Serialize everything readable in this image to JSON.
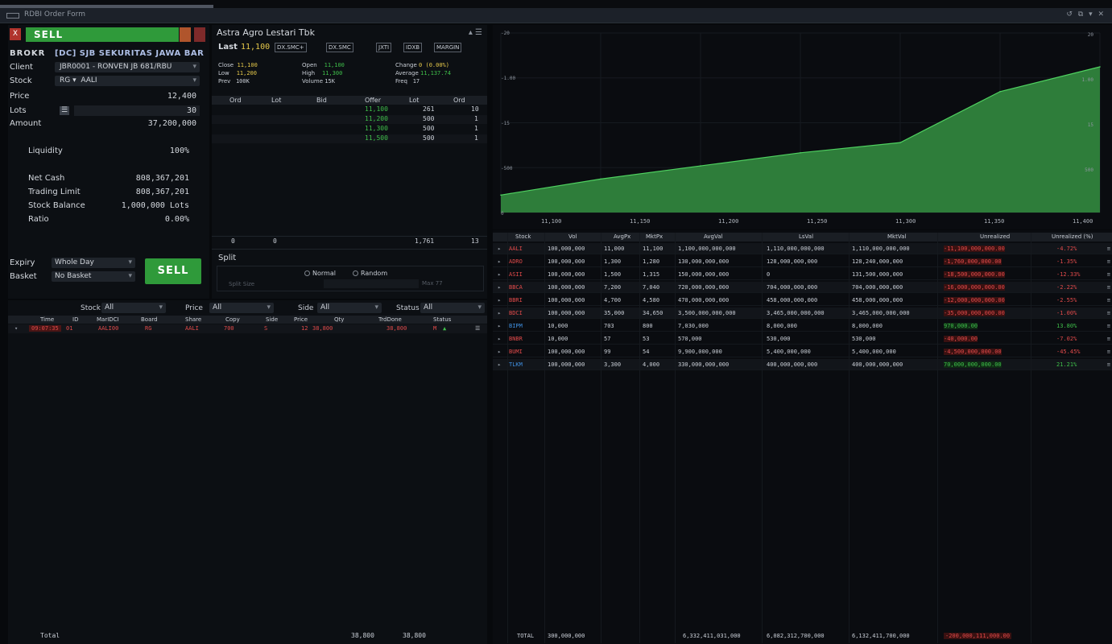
{
  "window": {
    "title": "RDBI Order Form",
    "controls": "↺ ⧉ ▾ ✕"
  },
  "order": {
    "side_label": "SELL",
    "close_label": "X",
    "broker_label": "BROKR",
    "broker_value": "[DC] SJB SEKURITAS JAWA BAR",
    "client_label": "Client",
    "client_value": "JBR0001 - RONVEN JB 681/RBU",
    "stock_label": "Stock",
    "stock_board": "RG ▾",
    "stock_code": "AALI",
    "price_label": "Price",
    "price_value": "12,400",
    "lots_label": "Lots",
    "lots_value": "30",
    "amount_label": "Amount",
    "amount_value": "37,200,000",
    "liquidity_label": "Liquidity",
    "liquidity_value": "100%",
    "netcash_label": "Net Cash",
    "netcash_value": "808,367,201",
    "tradinglimit_label": "Trading Limit",
    "tradinglimit_value": "808,367,201",
    "stockbalance_label": "Stock Balance",
    "stockbalance_value": "1,000,000 Lots",
    "ratio_label": "Ratio",
    "ratio_value": "0.00%",
    "expiry_label": "Expiry",
    "expiry_value": "Whole Day",
    "basket_label": "Basket",
    "basket_value": "No Basket",
    "submit_label": "SELL"
  },
  "quote": {
    "title": "Astra Agro Lestari Tbk",
    "last_label": "Last",
    "last_value": "11,100",
    "badges": [
      "DX.SMC+",
      "DX.SMC",
      "JXTI",
      "IDXB",
      "MARGIN"
    ],
    "close_label": "Close",
    "close_value": "11,100",
    "low_label": "Low",
    "low_value": "11,200",
    "prev_label": "Prev",
    "prev_value": "100K",
    "open_label": "Open",
    "open_value": "11,100",
    "high_label": "High",
    "high_value": "11,300",
    "volume_label": "Volume",
    "volume_value": "15K",
    "change_label": "Change",
    "change_value": "0 (0.00%)",
    "average_label": "Average",
    "average_value": "11,137.74",
    "freq_label": "Freq",
    "freq_value": "17",
    "book_headers": [
      "Ord",
      "Lot",
      "Bid",
      "Offer",
      "Lot",
      "Ord"
    ],
    "book_rows": [
      {
        "offer": "11,100",
        "lot": "261",
        "ord": "10"
      },
      {
        "offer": "11,200",
        "lot": "500",
        "ord": "1"
      },
      {
        "offer": "11,300",
        "lot": "500",
        "ord": "1"
      },
      {
        "offer": "11,500",
        "lot": "500",
        "ord": "1"
      }
    ],
    "book_total": {
      "bid_ord": "0",
      "bid_lot": "0",
      "offer_lot": "1,761",
      "offer_ord": "13"
    },
    "split_label": "Split",
    "radio_normal": "Normal",
    "radio_random": "Random",
    "split_placeholder": "Split Size",
    "split_max": "Max 77"
  },
  "orders": {
    "filter_stock_label": "Stock",
    "filter_stock_value": "All",
    "filter_price_label": "Price",
    "filter_price_value": "All",
    "filter_side_label": "Side",
    "filter_side_value": "All",
    "filter_status_label": "Status",
    "filter_status_value": "All",
    "headers": [
      "Time",
      "ID",
      "MarIDCI",
      "Board",
      "Share",
      "Copy",
      "Side",
      "Price",
      "Qty",
      "TrdDone",
      "Status"
    ],
    "row": {
      "time": "09:07:35",
      "id": "01",
      "mar": "AALI00",
      "board": "RG",
      "share": "AALI",
      "copy": "700",
      "side": "S",
      "price": "12",
      "qty": "38,800",
      "trd": "38,800",
      "status": "M"
    },
    "total_label": "Total",
    "total_qty": "38,800",
    "total_trd": "38,800"
  },
  "chart_data": {
    "type": "area",
    "x": [
      11000,
      11100,
      11200,
      11300,
      11400,
      11500,
      11600
    ],
    "y": [
      0.12,
      0.23,
      0.32,
      0.41,
      0.48,
      0.83,
      1.0
    ],
    "xlabels": [
      "11,100",
      "11,150",
      "11,200",
      "11,250",
      "11,300",
      "11,350",
      "11,400"
    ],
    "ylabels_left": [
      "-20",
      "-1.00",
      "-15",
      "-500",
      "0"
    ],
    "ylabels_right": [
      "20",
      "1.00",
      "15",
      "500"
    ],
    "fill": "#2e7d3a",
    "line": "#4fd160"
  },
  "portfolio": {
    "headers": [
      "Stock",
      "Vol",
      "AvgPx",
      "MktPx",
      "AvgVal",
      "LsVal",
      "MktVal",
      "Unrealized",
      "Unrealized (%)"
    ],
    "rows": [
      {
        "stock": "AALI",
        "vol": "100,000,000",
        "avg": "11,000",
        "mkt": "11,100",
        "avgval": "1,100,000,000,000",
        "lsval": "1,110,000,000,000",
        "mktval": "1,110,000,000,000",
        "unr": "-11,100,000,000.00",
        "pct": "-4.72%",
        "neg": true,
        "hl": true
      },
      {
        "stock": "ADRO",
        "vol": "100,000,000",
        "avg": "1,300",
        "mkt": "1,280",
        "avgval": "130,000,000,000",
        "lsval": "128,000,000,000",
        "mktval": "128,240,000,000",
        "unr": "-1,760,000,000.00",
        "pct": "-1.35%",
        "neg": true,
        "hl": false
      },
      {
        "stock": "ASII",
        "vol": "100,000,000",
        "avg": "1,500",
        "mkt": "1,315",
        "avgval": "150,000,000,000",
        "lsval": "0",
        "mktval": "131,500,000,000",
        "unr": "-18,500,000,000.00",
        "pct": "-12.33%",
        "neg": true,
        "hl": false
      },
      {
        "stock": "BBCA",
        "vol": "100,000,000",
        "avg": "7,200",
        "mkt": "7,040",
        "avgval": "720,000,000,000",
        "lsval": "704,000,000,000",
        "mktval": "704,000,000,000",
        "unr": "-16,000,000,000.00",
        "pct": "-2.22%",
        "neg": true,
        "hl": true
      },
      {
        "stock": "BBRI",
        "vol": "100,000,000",
        "avg": "4,700",
        "mkt": "4,580",
        "avgval": "470,000,000,000",
        "lsval": "458,000,000,000",
        "mktval": "458,000,000,000",
        "unr": "-12,000,000,000.00",
        "pct": "-2.55%",
        "neg": true,
        "hl": false
      },
      {
        "stock": "BDCI",
        "vol": "100,000,000",
        "avg": "35,000",
        "mkt": "34,650",
        "avgval": "3,500,000,000,000",
        "lsval": "3,465,000,000,000",
        "mktval": "3,465,000,000,000",
        "unr": "-35,000,000,000.00",
        "pct": "-1.00%",
        "neg": true,
        "hl": true
      },
      {
        "stock": "BIPM",
        "vol": "10,000",
        "avg": "703",
        "mkt": "800",
        "avgval": "7,030,000",
        "lsval": "8,000,000",
        "mktval": "8,000,000",
        "unr": "970,000.00",
        "pct": "13.80%",
        "neg": false,
        "hl": false
      },
      {
        "stock": "BNBR",
        "vol": "10,000",
        "avg": "57",
        "mkt": "53",
        "avgval": "570,000",
        "lsval": "530,000",
        "mktval": "530,000",
        "unr": "-40,000.00",
        "pct": "-7.02%",
        "neg": true,
        "hl": false
      },
      {
        "stock": "BUMI",
        "vol": "100,000,000",
        "avg": "99",
        "mkt": "54",
        "avgval": "9,900,000,000",
        "lsval": "5,400,000,000",
        "mktval": "5,400,000,000",
        "unr": "-4,500,000,000.00",
        "pct": "-45.45%",
        "neg": true,
        "hl": false
      },
      {
        "stock": "TLKM",
        "vol": "100,000,000",
        "avg": "3,300",
        "mkt": "4,000",
        "avgval": "330,000,000,000",
        "lsval": "400,000,000,000",
        "mktval": "400,000,000,000",
        "unr": "70,000,000,000.00",
        "pct": "21.21%",
        "neg": false,
        "hl": true
      }
    ],
    "total_label": "TOTAL",
    "total_vol": "300,000,000",
    "total_avgval": "6,332,411,031,000",
    "total_lsval": "6,082,312,700,000",
    "total_mktval": "6,132,411,700,000",
    "total_unr": "-200,000,111,000.00"
  }
}
